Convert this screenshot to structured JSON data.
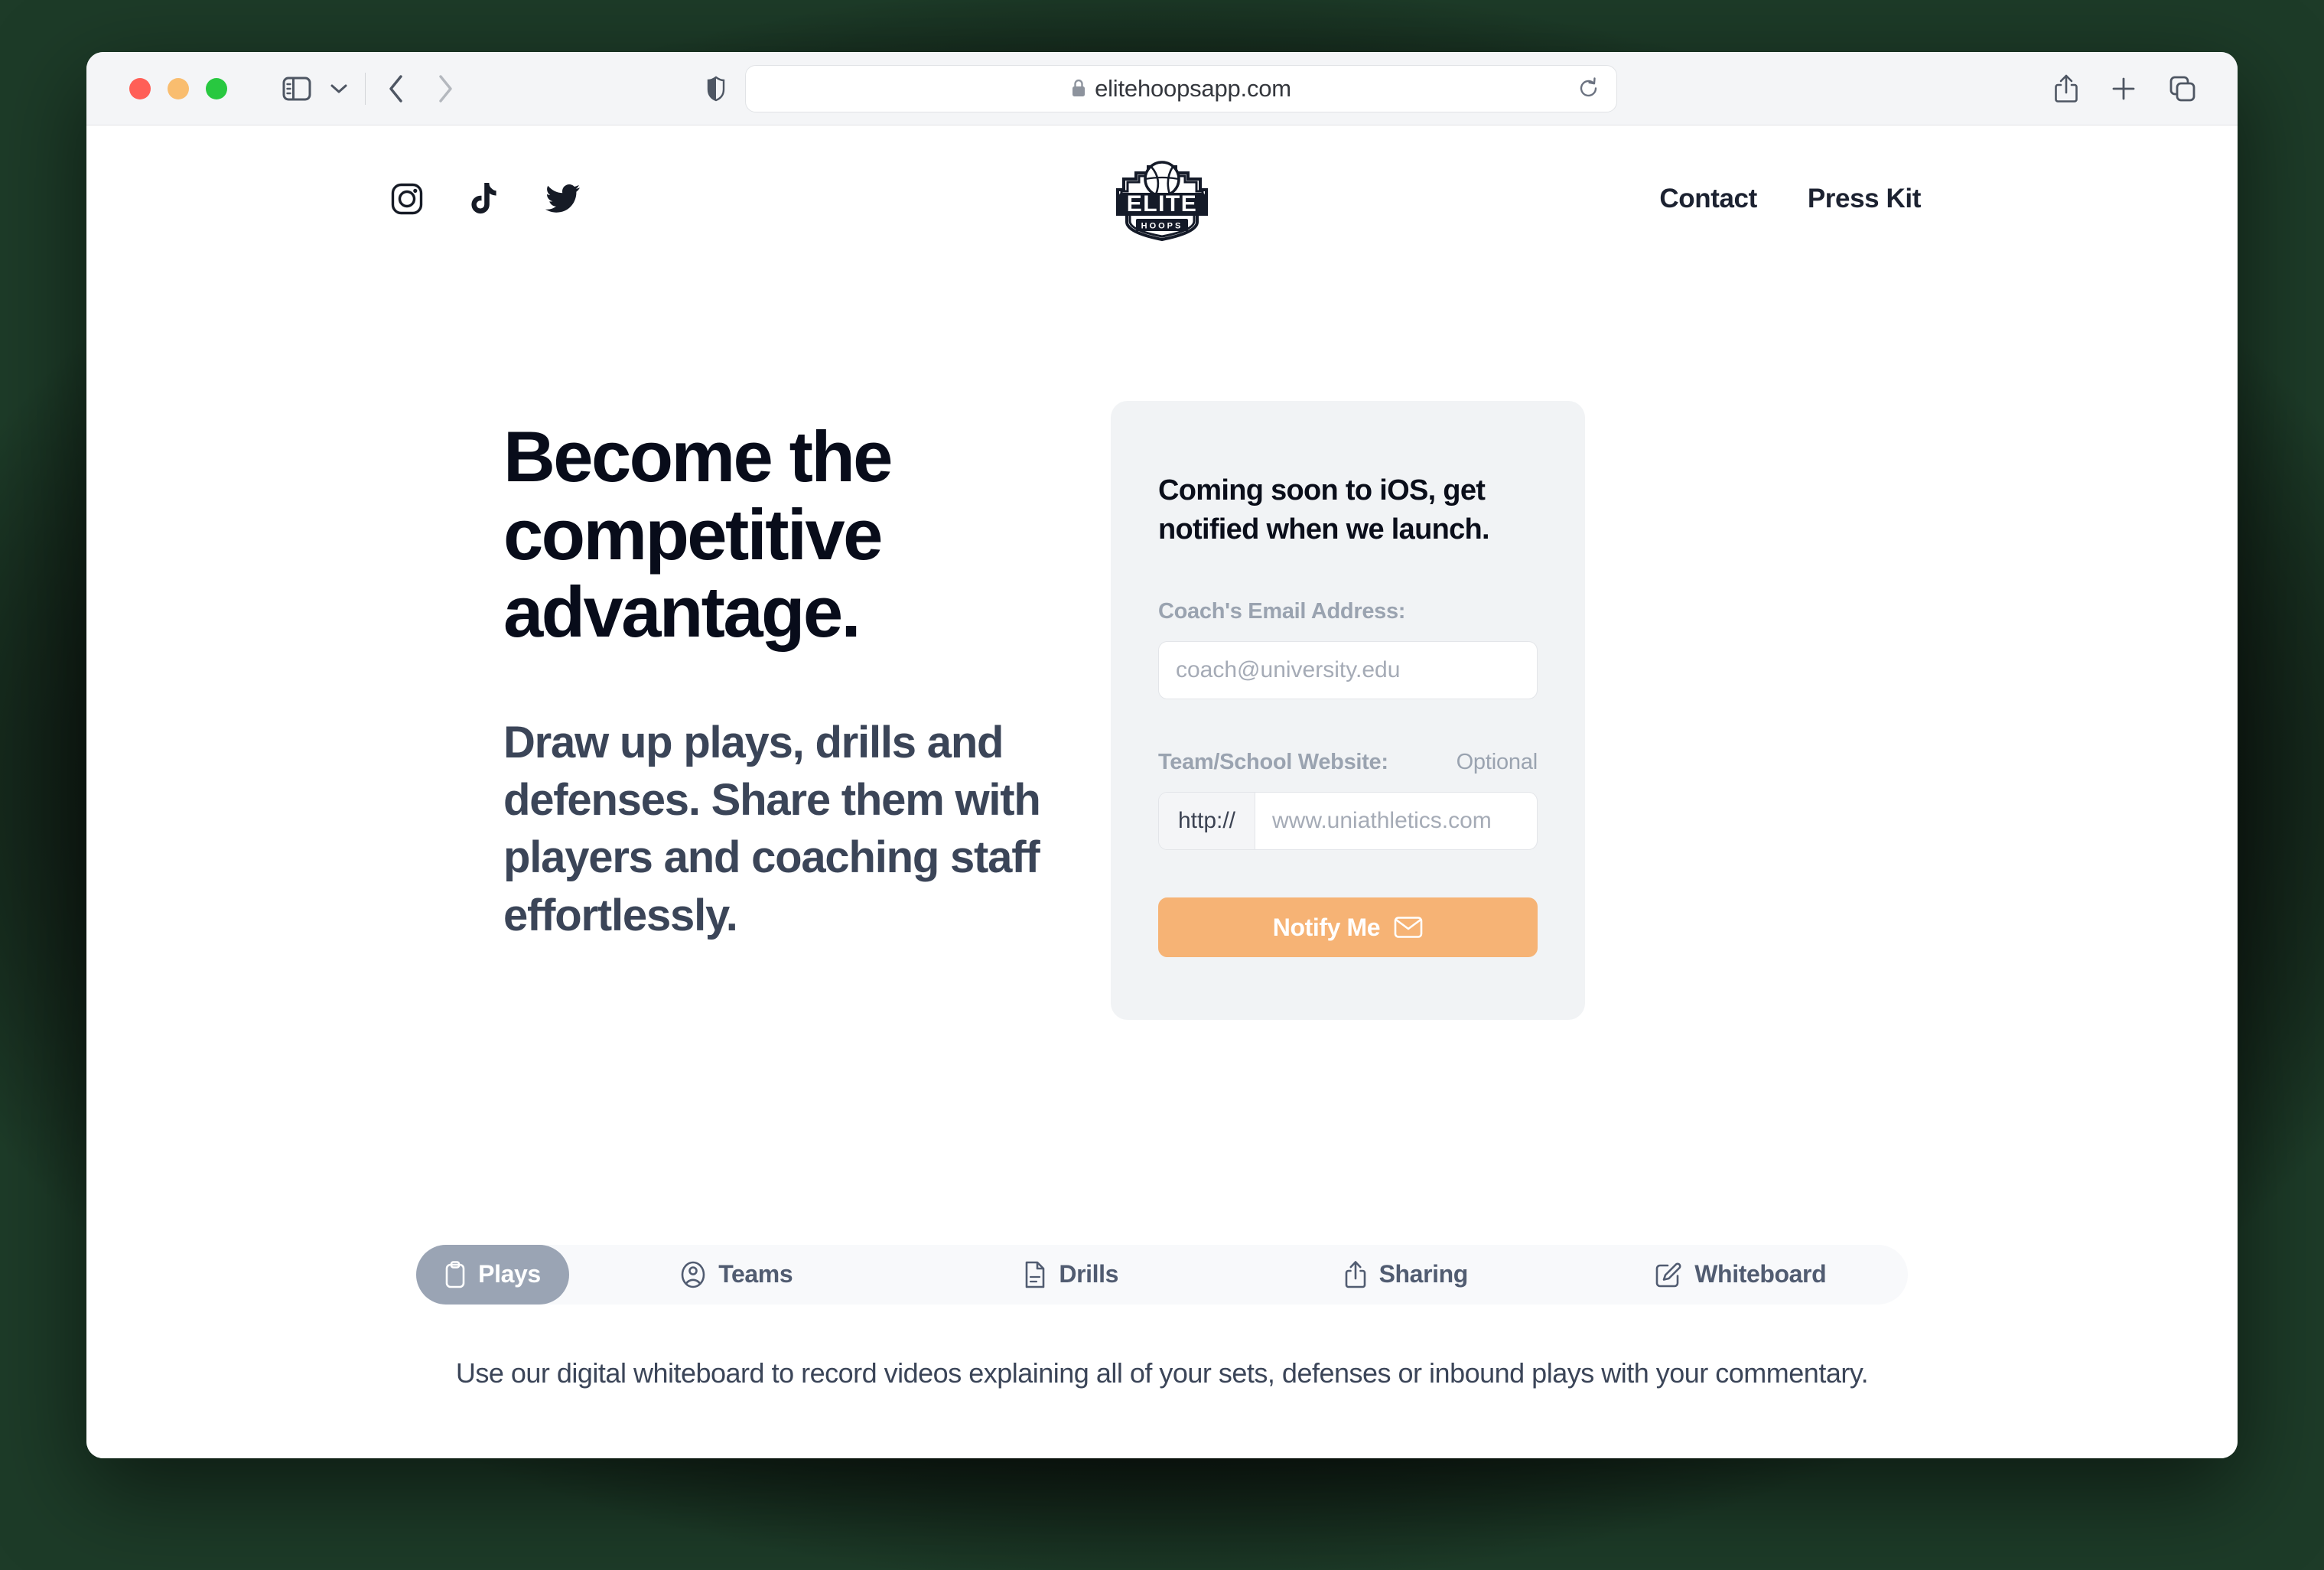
{
  "browser": {
    "url": "elitehoopsapp.com",
    "lock_icon": "lock-icon",
    "traffic_lights": [
      "close",
      "minimize",
      "zoom"
    ],
    "sidebar_icon": "sidebar-toggle-icon",
    "dropdown_icon": "chevron-down-icon",
    "back_icon": "chevron-left-icon",
    "forward_icon": "chevron-right-icon",
    "shield_icon": "privacy-shield-icon",
    "reload_icon": "reload-icon",
    "share_icon": "share-icon",
    "new_tab_icon": "plus-icon",
    "tab_overview_icon": "tab-overview-icon"
  },
  "site_header": {
    "social": [
      {
        "name": "instagram",
        "label": "Instagram"
      },
      {
        "name": "tiktok",
        "label": "TikTok"
      },
      {
        "name": "twitter",
        "label": "Twitter"
      }
    ],
    "logo": {
      "primary_text": "ELITE",
      "secondary_text": "HOOPS"
    },
    "nav": [
      {
        "label": "Contact"
      },
      {
        "label": "Press Kit"
      }
    ]
  },
  "hero": {
    "title": "Become the competitive advantage.",
    "subtitle": "Draw up plays, drills and defenses. Share them with players and coaching staff effortlessly."
  },
  "signup": {
    "heading": "Coming soon to iOS, get notified when we launch.",
    "email_label": "Coach's Email Address:",
    "email_placeholder": "coach@university.edu",
    "email_value": "",
    "website_label": "Team/School Website:",
    "website_optional": "Optional",
    "website_prefix": "http://",
    "website_placeholder": "www.uniathletics.com",
    "website_value": "",
    "submit_label": "Notify Me",
    "submit_icon": "envelope-icon",
    "accent_color": "#f6b375",
    "card_bg": "#f1f3f5"
  },
  "features": {
    "tabs": [
      {
        "label": "Plays",
        "icon": "clipboard-icon",
        "active": true
      },
      {
        "label": "Teams",
        "icon": "person-circle-icon",
        "active": false
      },
      {
        "label": "Drills",
        "icon": "document-icon",
        "active": false
      },
      {
        "label": "Sharing",
        "icon": "share-icon",
        "active": false
      },
      {
        "label": "Whiteboard",
        "icon": "pencil-square-icon",
        "active": false
      }
    ],
    "description": "Use our digital whiteboard to record videos explaining all of your sets, defenses or inbound plays with your commentary.",
    "active_tab_color": "#9aa4b4"
  }
}
